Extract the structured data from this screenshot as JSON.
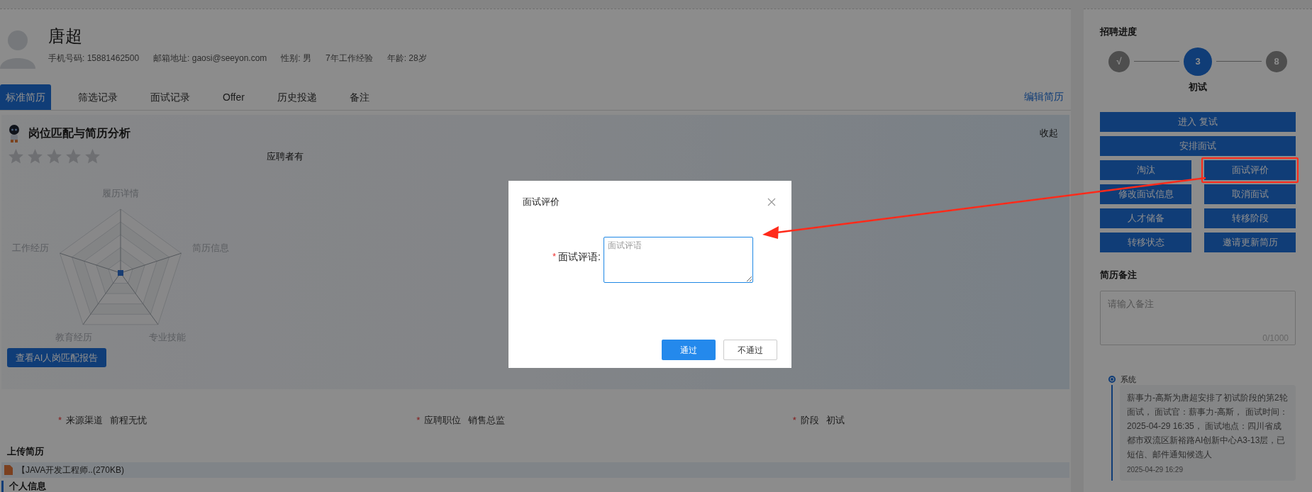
{
  "profile": {
    "name": "唐超",
    "details": [
      "手机号码: 15881462500",
      "邮箱地址: gaosi@seeyon.com",
      "性别: 男",
      "7年工作经验",
      "年龄: 28岁"
    ]
  },
  "tabs": [
    {
      "label": "标准简历",
      "selected": true
    },
    {
      "label": "筛选记录",
      "selected": false
    },
    {
      "label": "面试记录",
      "selected": false
    },
    {
      "label": "Offer",
      "selected": false
    },
    {
      "label": "历史投递",
      "selected": false
    },
    {
      "label": "备注",
      "selected": false
    }
  ],
  "edit_link": "编辑简历",
  "analysis": {
    "title": "岗位匹配与简历分析",
    "collapse": "收起",
    "stars": 0,
    "summary": "应聘者有",
    "radar_labels": [
      "履历详情",
      "简历信息",
      "专业技能",
      "教育经历",
      "工作经历"
    ],
    "report_button": "查看AI人岗匹配报告"
  },
  "fields": [
    {
      "marker": "*",
      "label": "来源渠道",
      "value": "前程无忧"
    },
    {
      "marker": "*",
      "label": "应聘职位",
      "value": "销售总监"
    },
    {
      "marker": "*",
      "label": "阶段",
      "value": "初试"
    }
  ],
  "upload": {
    "title": "上传简历",
    "file": "【JAVA开发工程师..(270KB)"
  },
  "section_title": "个人信息",
  "sidebar": {
    "progress_title": "招聘进度",
    "steps": [
      {
        "mark": "√",
        "current": false
      },
      {
        "mark": "3",
        "current": true
      },
      {
        "mark": "8",
        "current": false
      }
    ],
    "current_stage": "初试",
    "actions": [
      {
        "label": "进入 复试",
        "wide": true,
        "highlighted": false
      },
      {
        "label": "安排面试",
        "wide": true,
        "highlighted": false
      },
      {
        "label": "淘汰",
        "wide": false,
        "highlighted": false
      },
      {
        "label": "面试评价",
        "wide": false,
        "highlighted": true
      },
      {
        "label": "修改面试信息",
        "wide": false,
        "highlighted": false
      },
      {
        "label": "取消面试",
        "wide": false,
        "highlighted": false
      },
      {
        "label": "人才储备",
        "wide": false,
        "highlighted": false
      },
      {
        "label": "转移阶段",
        "wide": false,
        "highlighted": false
      },
      {
        "label": "转移状态",
        "wide": false,
        "highlighted": false
      },
      {
        "label": "邀请更新简历",
        "wide": false,
        "highlighted": false
      }
    ],
    "notes_title": "简历备注",
    "notes_placeholder": "请输入备注",
    "notes_counter": "0/1000",
    "timeline": [
      {
        "author": "系统",
        "text": "薪事力-高斯为唐超安排了初试阶段的第2轮面试， 面试官：薪事力-高斯， 面试时间：2025-04-29 16:35， 面试地点：四川省成都市双流区新裕路AI创新中心A3-13层，已短信、邮件通知候选人",
        "time": "2025-04-29 16:29"
      }
    ]
  },
  "dialog": {
    "title": "面试评价",
    "field_marker": "*",
    "field_label": "面试评语:",
    "placeholder": "面试评语",
    "buttons": [
      {
        "label": "通过",
        "kind": "primary"
      },
      {
        "label": "不通过",
        "kind": "secondary"
      }
    ]
  }
}
